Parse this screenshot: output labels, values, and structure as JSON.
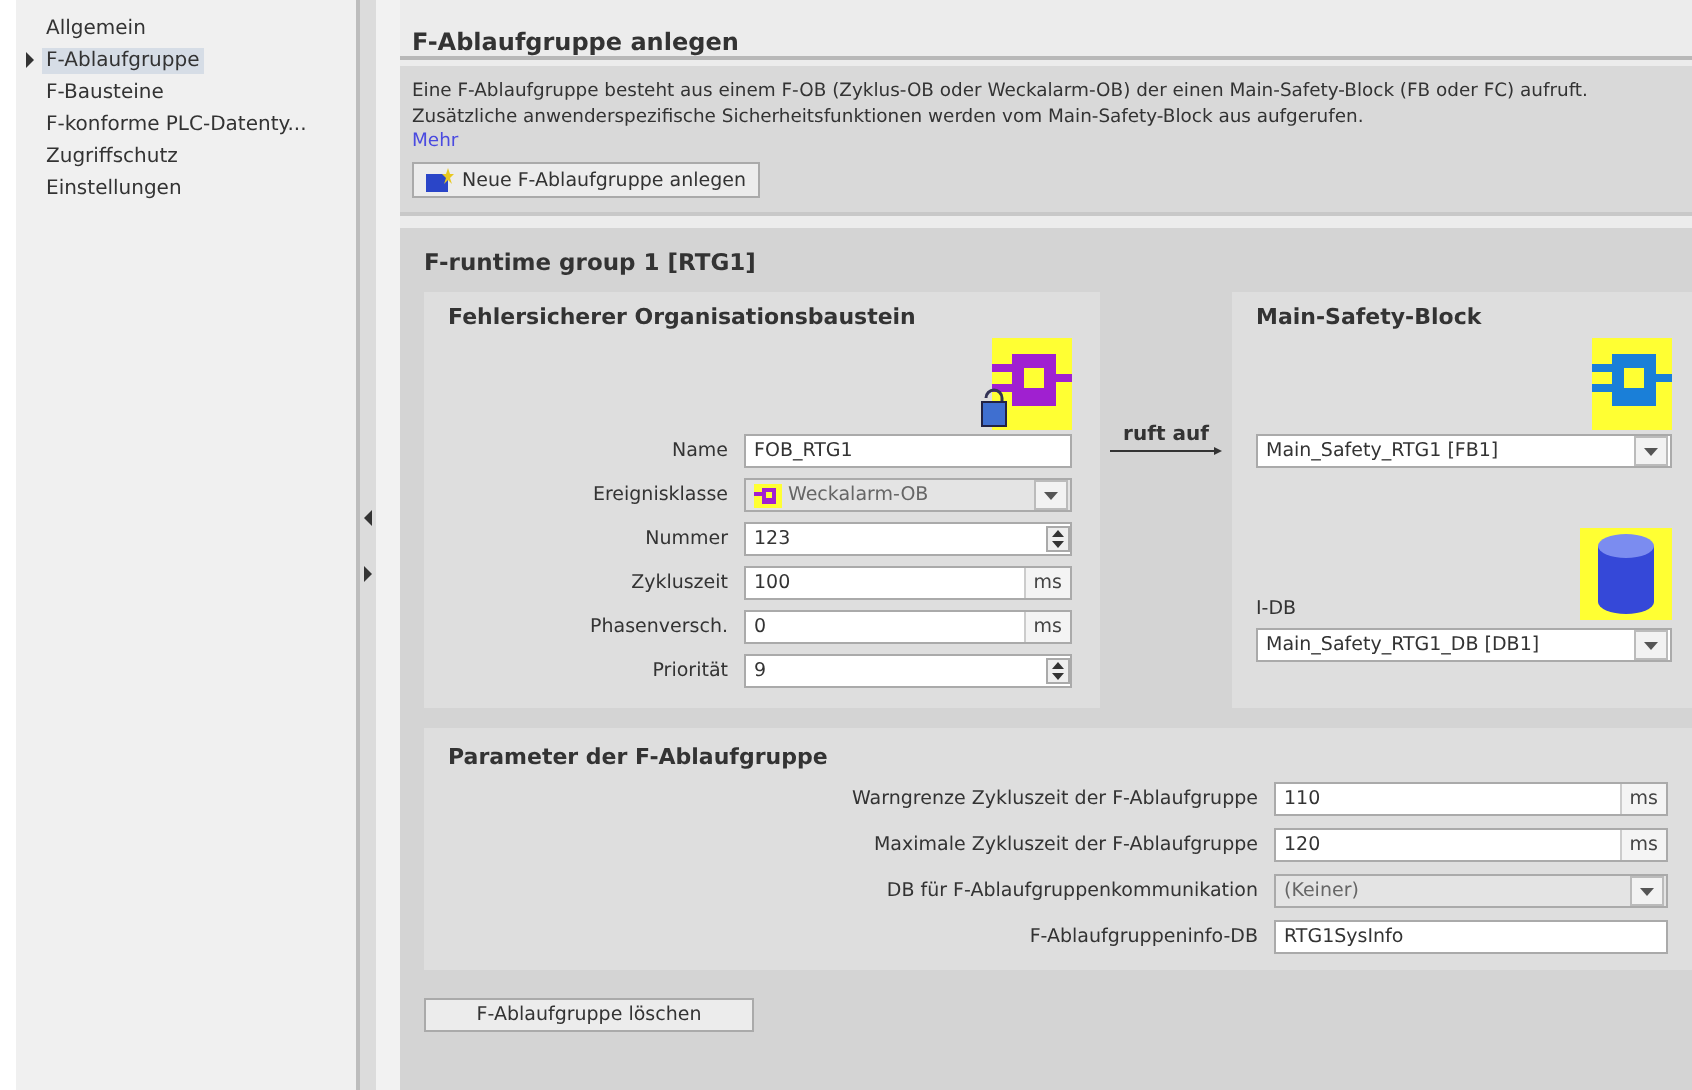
{
  "sidebar": {
    "items": [
      {
        "label": "Allgemein",
        "selected": false
      },
      {
        "label": "F-Ablaufgruppe",
        "selected": true
      },
      {
        "label": "F-Bausteine",
        "selected": false
      },
      {
        "label": "F-konforme PLC-Datenty...",
        "selected": false
      },
      {
        "label": "Zugriffschutz",
        "selected": false
      },
      {
        "label": "Einstellungen",
        "selected": false
      }
    ]
  },
  "section_title": "F-Ablaufgruppe anlegen",
  "info": {
    "text": "Eine F-Ablaufgruppe besteht aus einem F-OB (Zyklus-OB oder Weckalarm-OB) der einen Main-Safety-Block (FB oder FC) aufruft. Zusätzliche anwenderspezifische Sicherheitsfunktionen werden vom Main-Safety-Block aus aufgerufen.",
    "link": "Mehr",
    "button": "Neue F-Ablaufgruppe anlegen"
  },
  "group": {
    "title": "F-runtime group 1 [RTG1]",
    "fob": {
      "title": "Fehlersicherer Organisationsbaustein",
      "fields": [
        {
          "label": "Name",
          "kind": "text",
          "value": "FOB_RTG1"
        },
        {
          "label": "Ereignisklasse",
          "kind": "select",
          "value": "Weckalarm-OB",
          "disabled": true
        },
        {
          "label": "Nummer",
          "kind": "spinner",
          "value": "123"
        },
        {
          "label": "Zykluszeit",
          "kind": "unit",
          "value": "100",
          "unit": "ms"
        },
        {
          "label": "Phasenversch.",
          "kind": "unit",
          "value": "0",
          "unit": "ms"
        },
        {
          "label": "Priorität",
          "kind": "spinner",
          "value": "9"
        }
      ]
    },
    "calls_label": "ruft auf",
    "main_safety": {
      "title": "Main-Safety-Block",
      "block": "Main_Safety_RTG1 [FB1]",
      "idb_label": "I-DB",
      "idb": "Main_Safety_RTG1_DB [DB1]"
    },
    "parameters": {
      "title": "Parameter der F-Ablaufgruppe",
      "fields": [
        {
          "label": "Warngrenze Zykluszeit der F-Ablaufgruppe",
          "kind": "unit",
          "value": "110",
          "unit": "ms"
        },
        {
          "label": "Maximale Zykluszeit der F-Ablaufgruppe",
          "kind": "unit",
          "value": "120",
          "unit": "ms"
        },
        {
          "label": "DB für F-Ablaufgruppenkommunikation",
          "kind": "select",
          "value": "(Keiner)",
          "disabled": true
        },
        {
          "label": "F-Ablaufgruppeninfo-DB",
          "kind": "text",
          "value": "RTG1SysInfo"
        }
      ]
    },
    "delete_button": "F-Ablaufgruppe löschen"
  }
}
